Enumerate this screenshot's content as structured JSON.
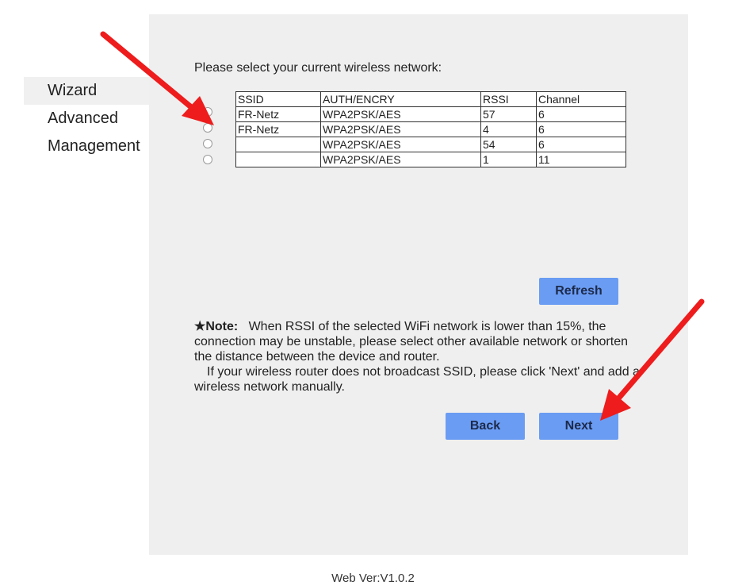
{
  "sidebar": {
    "items": [
      {
        "label": "Wizard",
        "active": true
      },
      {
        "label": "Advanced",
        "active": false
      },
      {
        "label": "Management",
        "active": false
      }
    ]
  },
  "main": {
    "prompt": "Please select your current wireless network:",
    "table": {
      "headers": [
        "SSID",
        "AUTH/ENCRY",
        "RSSI",
        "Channel"
      ],
      "rows": [
        [
          "FR-Netz",
          "WPA2PSK/AES",
          "57",
          "6"
        ],
        [
          "FR-Netz",
          "WPA2PSK/AES",
          "4",
          "6"
        ],
        [
          "",
          "WPA2PSK/AES",
          "54",
          "6"
        ],
        [
          "",
          "WPA2PSK/AES",
          "1",
          "11"
        ]
      ]
    },
    "refresh_label": "Refresh",
    "note": {
      "star": "★",
      "label": "Note:",
      "text1": "When RSSI of the selected WiFi network is lower than 15%,  the connection may be unstable,  please select other available network or shorten the distance between the device and router.",
      "text2": "If your wireless router does not broadcast SSID,  please click  'Next'  and add a wireless network manually."
    },
    "back_label": "Back",
    "next_label": "Next"
  },
  "footer": {
    "version": "Web Ver:V1.0.2"
  },
  "colors": {
    "button": "#6a9cf3",
    "panel": "#efefef",
    "annotation_arrow": "#ee1c1c"
  }
}
